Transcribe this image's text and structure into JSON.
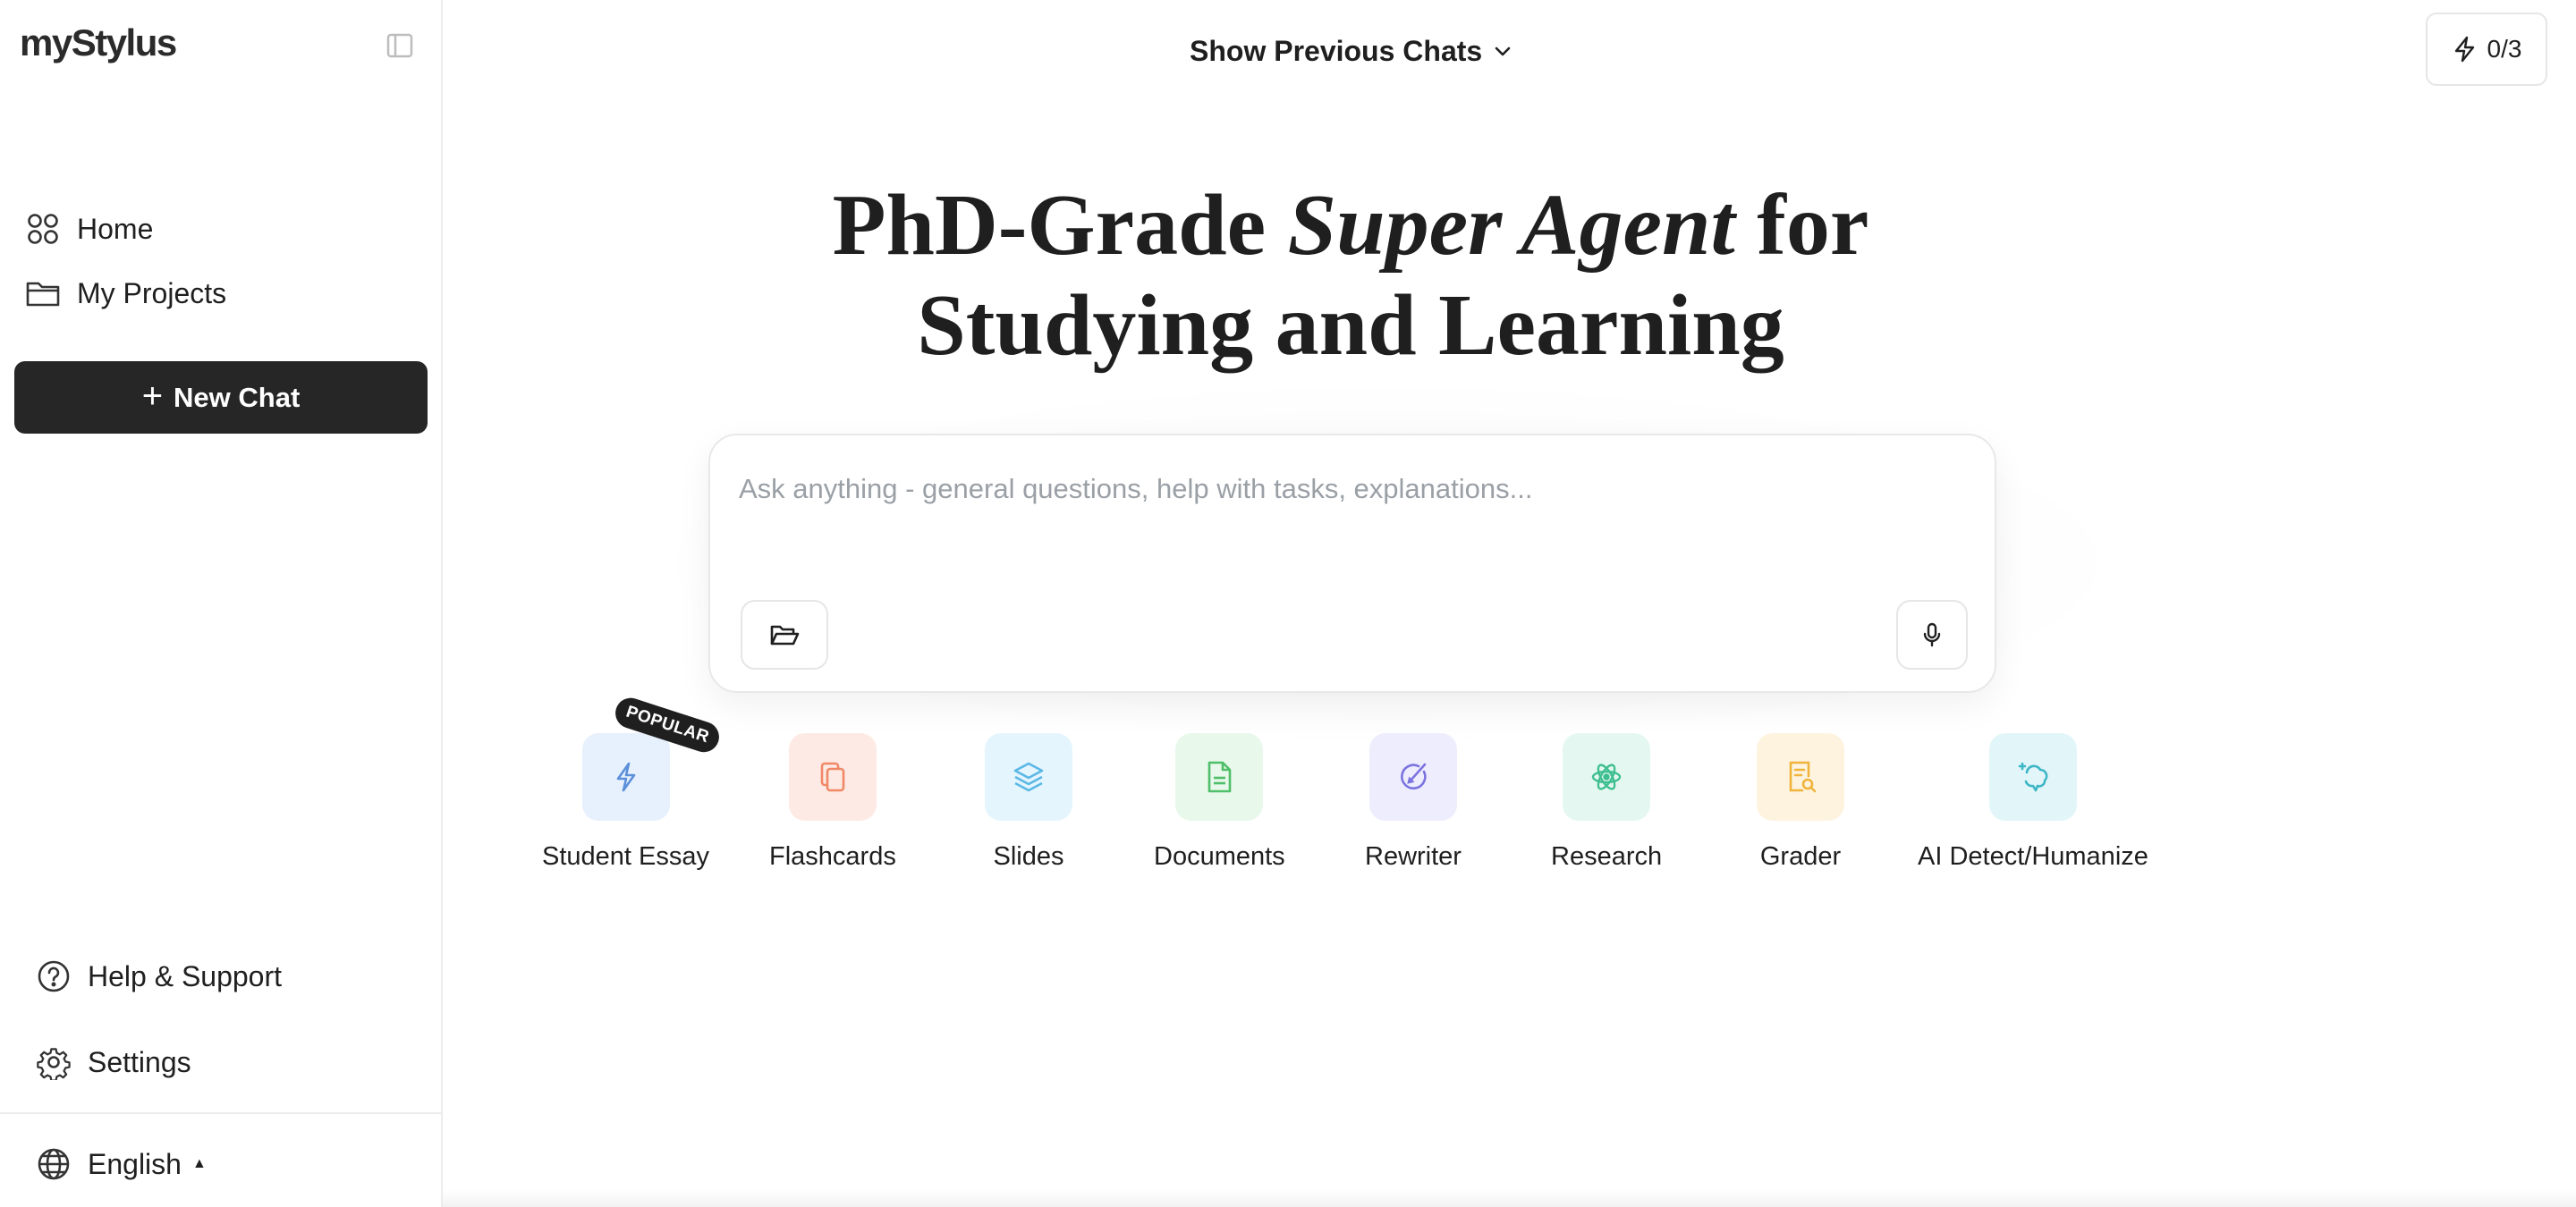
{
  "app": {
    "logo": "myStylus"
  },
  "sidebar": {
    "nav": [
      {
        "label": "Home",
        "icon": "grid-icon"
      },
      {
        "label": "My Projects",
        "icon": "folder-icon"
      }
    ],
    "new_chat_label": "New Chat",
    "bottom": {
      "help_label": "Help & Support",
      "settings_label": "Settings",
      "language_label": "English"
    }
  },
  "header": {
    "previous_chats_label": "Show Previous Chats",
    "credits_label": "0/3"
  },
  "hero": {
    "title_part1": "PhD-Grade ",
    "title_italic": "Super Agent",
    "title_part2": " for",
    "title_line2": "Studying and Learning"
  },
  "chat": {
    "placeholder": "Ask anything - general questions, help with tasks, explanations..."
  },
  "tools": {
    "popular_badge": "POPULAR",
    "items": [
      {
        "label": "Student Essay",
        "icon": "bolt-icon",
        "color": "#5b8fd9",
        "bg": "#e7f0fd"
      },
      {
        "label": "Flashcards",
        "icon": "cards-icon",
        "color": "#f08866",
        "bg": "#fdeae4"
      },
      {
        "label": "Slides",
        "icon": "layers-icon",
        "color": "#5bb8e6",
        "bg": "#e5f5fd"
      },
      {
        "label": "Documents",
        "icon": "document-icon",
        "color": "#4fbf69",
        "bg": "#e8f8ea"
      },
      {
        "label": "Rewriter",
        "icon": "rewrite-icon",
        "color": "#7b73e0",
        "bg": "#eeedfd"
      },
      {
        "label": "Research",
        "icon": "atom-icon",
        "color": "#3fbf8f",
        "bg": "#e4f8f1"
      },
      {
        "label": "Grader",
        "icon": "grade-doc-icon",
        "color": "#f0b43c",
        "bg": "#fdf3df"
      },
      {
        "label": "AI Detect/Humanize",
        "icon": "brain-icon",
        "color": "#3db6c6",
        "bg": "#e2f6f9"
      }
    ]
  }
}
